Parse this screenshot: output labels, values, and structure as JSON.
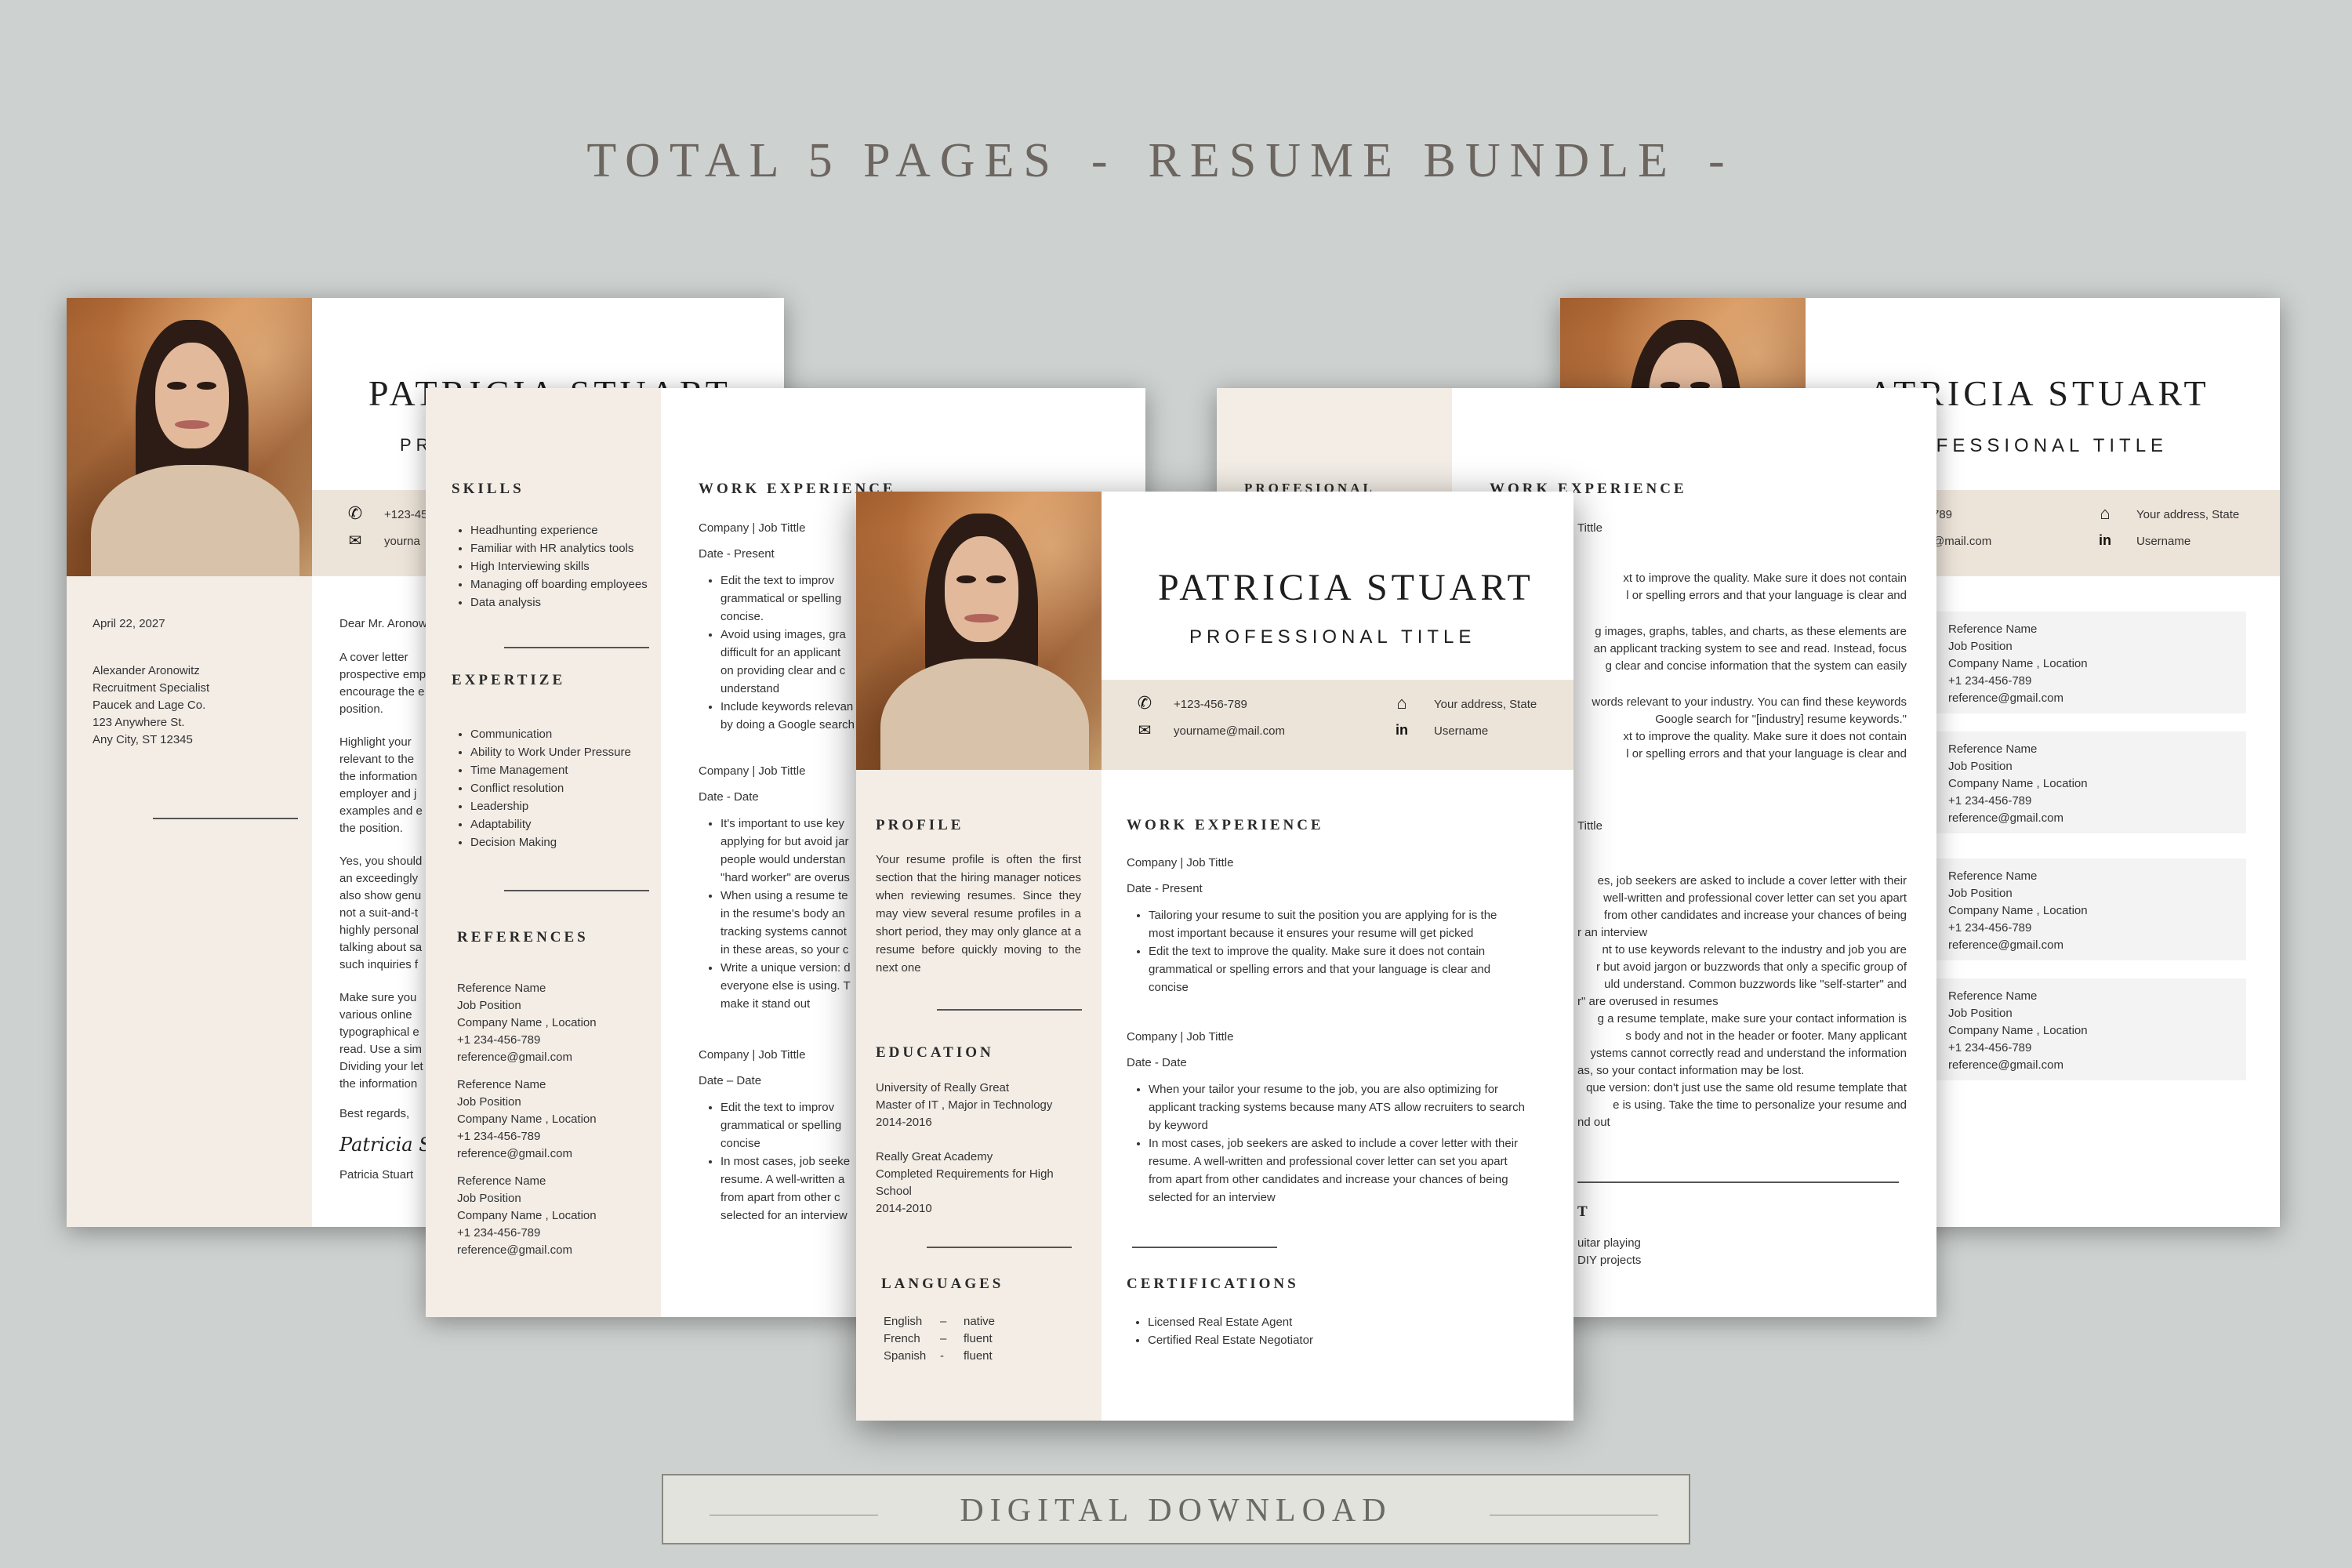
{
  "banner": {
    "part1": "TOTAL 5 PAGES",
    "sep1": "-",
    "part2": "RESUME BUNDLE",
    "sep2": "-"
  },
  "download": {
    "label": "DIGITAL DOWNLOAD"
  },
  "colors": {
    "background": "#cdd1cf",
    "cream": "#f3ede6",
    "band": "#ede4d9"
  },
  "person": {
    "name": "PATRICIA STUART",
    "title": "PROFESSIONAL TITLE"
  },
  "contact": {
    "phone": "+123-456-789",
    "email": "yourname@mail.com",
    "address": "Your address, State",
    "linkedin": "Username"
  },
  "icons": {
    "phone": "phone-icon",
    "email": "mail-icon",
    "address": "home-icon",
    "linkedin": "linkedin-icon"
  },
  "cover_letter": {
    "name_fragment": "PATRICIA STUART",
    "title_fragment": "PR",
    "phone_fragment": "+123-45",
    "email_fragment": "yourna",
    "date": "April 22, 2027",
    "recipient": [
      "Alexander Aronowitz",
      "Recruitment Specialist",
      "Paucek and Lage Co.",
      "123 Anywhere St.",
      "Any City, ST 12345"
    ],
    "greeting": "Dear Mr. Aronow",
    "body": [
      [
        "A cover letter",
        "prospective emp",
        "encourage the e",
        "position."
      ],
      [
        "Highlight your",
        "relevant to the",
        "the information",
        "employer and j",
        "examples and e",
        "the position."
      ],
      [
        "Yes, you should",
        "an exceedingly",
        "also show genu",
        "not a suit-and-t",
        "highly personal",
        "talking about sa",
        "such inquiries f"
      ],
      [
        "Make sure you",
        "various online",
        "typographical e",
        "read. Use a sim",
        "Dividing your let",
        "the information"
      ]
    ],
    "closing": "Best regards,",
    "signature": "Patricia St",
    "signed_name": "Patricia Stuart"
  },
  "left_page": {
    "skills_heading": "SKILLS",
    "skills": [
      "Headhunting experience",
      "Familiar with HR analytics tools",
      "High Interviewing skills",
      "Managing off boarding employees",
      "Data analysis"
    ],
    "expertise_heading": "EXPERTIZE",
    "expertise": [
      "Communication",
      "Ability to Work Under Pressure",
      "Time Management",
      "Conflict resolution",
      "Leadership",
      "Adaptability",
      "Decision Making"
    ],
    "references_heading": "REFERENCES",
    "references": [
      [
        "Reference Name",
        "Job Position",
        "Company Name , Location",
        "+1 234-456-789",
        "reference@gmail.com"
      ],
      [
        "Reference Name",
        "Job Position",
        "Company Name , Location",
        "+1 234-456-789",
        "reference@gmail.com"
      ],
      [
        "Reference Name",
        "Job Position",
        "Company Name , Location",
        "+1 234-456-789",
        "reference@gmail.com"
      ]
    ],
    "work_heading": "WORK EXPERIENCE",
    "jobs": [
      {
        "company": "Company | Job Tittle",
        "date": "Date - Present",
        "bullets": [
          [
            "Edit the text to improv",
            "grammatical or spelling",
            "concise."
          ],
          [
            "Avoid using images, gra",
            "difficult for an applicant",
            "on providing clear and c",
            "understand"
          ],
          [
            "Include keywords relevan",
            "by doing a Google search"
          ]
        ]
      },
      {
        "company": "Company | Job Tittle",
        "date": "Date - Date",
        "bullets": [
          [
            "It's important to use key",
            "applying for but avoid jar",
            "people would understan",
            "\"hard worker\" are overus"
          ],
          [
            "When using a resume te",
            "in the resume's body an",
            "tracking systems cannot",
            "in these areas, so your c"
          ],
          [
            "Write a unique version: d",
            "everyone else is using. T",
            "make it stand out"
          ]
        ]
      },
      {
        "company": "Company | Job Tittle",
        "date": "Date – Date",
        "bullets": [
          [
            "Edit the text to improv",
            "grammatical or spelling",
            "concise"
          ],
          [
            "In most cases, job seeke",
            "resume. A well-written a",
            "from apart from other c",
            "selected for an interview"
          ]
        ]
      }
    ]
  },
  "front_page": {
    "profile_heading": "PROFILE",
    "profile_text": "Your resume profile is often the first section that the hiring manager notices when reviewing resumes. Since they may view several resume profiles in a short period, they may only glance at a resume before quickly moving to the next one",
    "education_heading": "EDUCATION",
    "education": [
      [
        "University  of Really Great",
        "Master of IT , Major in Technology",
        "2014-2016"
      ],
      [
        "Really Great Academy",
        "Completed Requirements for High",
        "School",
        "2014-2010"
      ]
    ],
    "languages_heading": "LANGUAGES",
    "languages": [
      [
        "English",
        "–",
        "native"
      ],
      [
        "French",
        "–",
        "fluent"
      ],
      [
        "Spanish",
        "-",
        "fluent"
      ]
    ],
    "work_heading": "WORK EXPERIENCE",
    "jobs": [
      {
        "company": "Company | Job Tittle",
        "date": "Date - Present",
        "bullets": [
          [
            "Tailoring your resume to suit the position you are applying for is the",
            "most important because it ensures your resume will get picked"
          ],
          [
            "Edit the text to improve the quality. Make sure it does not contain",
            "grammatical or spelling errors and that your language is clear and",
            "concise"
          ]
        ]
      },
      {
        "company": "Company | Job Tittle",
        "date": "Date - Date",
        "bullets": [
          [
            "When your tailor your resume to the job, you are also optimizing for",
            "applicant tracking systems because many ATS allow recruiters to search",
            "by keyword"
          ],
          [
            "In most cases, job seekers are asked to include a cover letter with their",
            "resume. A well-written and professional cover letter can set you apart",
            "from apart from other candidates and increase your chances of being",
            "selected for an interview"
          ]
        ]
      }
    ],
    "cert_heading": "CERTIFICATIONS",
    "certifications": [
      "Licensed Real Estate Agent",
      "Certified Real Estate Negotiator"
    ]
  },
  "right_page": {
    "side_heading_fragment": "PROFESIONAL",
    "work_heading": "WORK EXPERIENCE",
    "job1_company_fragment": "Tittle",
    "job1_lines": [
      "xt to improve the quality. Make sure it does not contain",
      "l or spelling errors and that your language is clear and",
      "",
      "g images, graphs, tables, and charts, as these elements are",
      "an applicant tracking system to see and read. Instead, focus",
      "g clear and concise information that the system can easily",
      "",
      "words relevant to your industry. You can find these keywords",
      "Google search for \"[industry] resume keywords.\"",
      "xt to improve the quality. Make sure it does not contain",
      "l or spelling errors and that your language is clear and"
    ],
    "job2_company_fragment": "Tittle",
    "job2_lines": [
      "es, job seekers are asked to include a cover letter with their",
      "well-written and professional cover letter can set you apart",
      "from other candidates and increase your chances of being",
      "r an interview",
      "nt to use keywords relevant to the industry and job you are",
      "r but avoid jargon or buzzwords that only a specific group of",
      "uld understand. Common buzzwords like \"self-starter\" and",
      "r\" are overused in resumes",
      "g a resume template, make sure your contact information is",
      "s body and not in the header or footer. Many applicant",
      "ystems cannot correctly read and understand the information",
      "as, so your contact information may be lost.",
      "que version: don't just use the same old resume template that",
      "e is using. Take the time to personalize your resume and",
      "nd out"
    ],
    "interest_heading_fragment": "T",
    "interests": [
      "uitar playing",
      "DIY projects"
    ]
  },
  "back_right_page": {
    "name_fragment": "ATRICIA STUART",
    "title_fragment": "OFESSIONAL TITLE",
    "phone_fragment": "789",
    "email_fragment": "@mail.com",
    "address": "Your address, State",
    "linkedin": "Username",
    "references": [
      [
        "Reference Name",
        "Job Position",
        "Company Name , Location",
        "+1 234-456-789",
        "reference@gmail.com"
      ],
      [
        "Reference Name",
        "Job Position",
        "Company Name , Location",
        "+1 234-456-789",
        "reference@gmail.com"
      ],
      [
        "Reference Name",
        "Job Position",
        "Company Name , Location",
        "+1 234-456-789",
        "reference@gmail.com"
      ],
      [
        "Reference Name",
        "Job Position",
        "Company Name , Location",
        "+1 234-456-789",
        "reference@gmail.com"
      ]
    ]
  }
}
